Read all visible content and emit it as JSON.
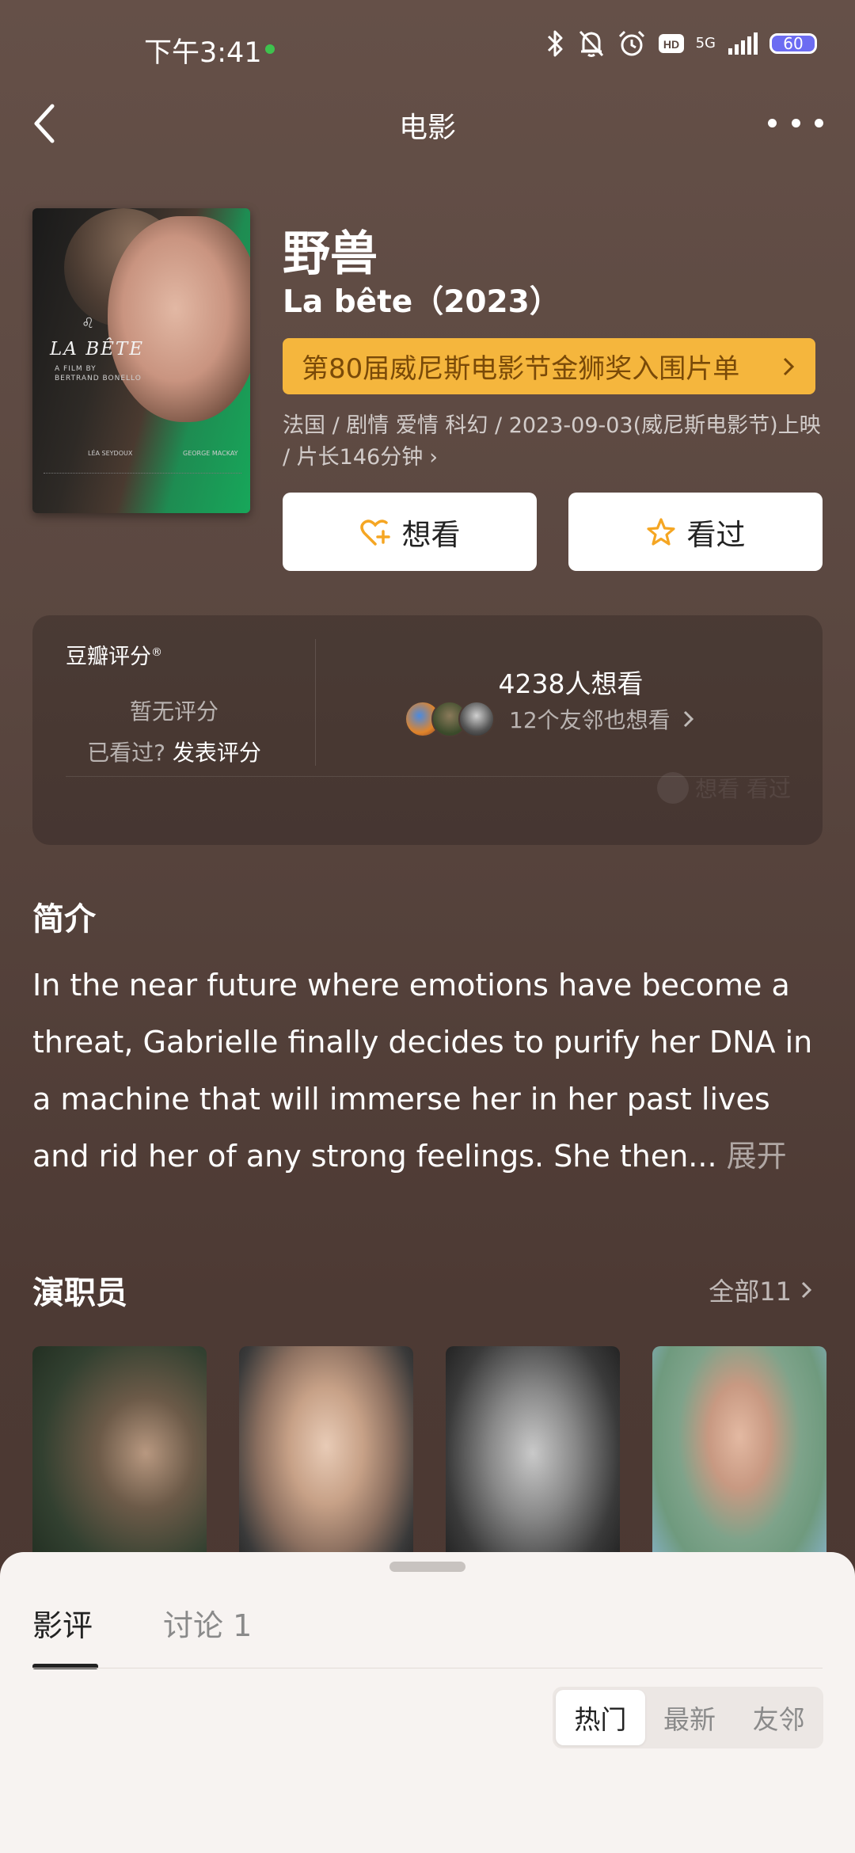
{
  "status_bar": {
    "time": "下午3:41",
    "network": "5G",
    "battery": "60"
  },
  "nav": {
    "title": "电影"
  },
  "movie": {
    "title": "野兽",
    "original_title": "La bête（2023）",
    "award": "第80届威尼斯电影节金狮奖入围片单",
    "meta": "法国 / 剧情 爱情 科幻 / 2023-09-03(威尼斯电影节)上映 / 片长146分钟",
    "poster": {
      "title": "LA BÊTE",
      "subtitle": "A FILM BY",
      "director": "BERTRAND BONELLO",
      "actor1": "LÉA SEYDOUX",
      "actor2": "GEORGE MACKAY"
    }
  },
  "actions": {
    "want_label": "想看",
    "seen_label": "看过"
  },
  "rating": {
    "label": "豆瓣评分",
    "mark": "®",
    "none": "暂无评分",
    "prompt": "已看过?",
    "write": "发表评分",
    "want_count": "4238人想看",
    "friends": "12个友邻也想看",
    "watermark": "想看 看过"
  },
  "intro": {
    "title": "简介",
    "text": "In the near future where emotions have become a threat, Gabrielle finally decides to purify her DNA in a machine that will immerse her in her past lives and rid her of any strong feelings. She then...",
    "expand": "展开"
  },
  "cast": {
    "title": "演职员",
    "all": "全部11"
  },
  "sheet": {
    "tabs": [
      "影评",
      "讨论 1"
    ],
    "sort": [
      "热门",
      "最新",
      "友邻"
    ]
  },
  "colors": {
    "accent": "#f5b63d",
    "background": "#4d3a33",
    "sheet": "#f7f3f1"
  },
  "icons": [
    "back-icon",
    "more-icon",
    "heart-plus-icon",
    "star-icon",
    "chevron-right-icon",
    "bluetooth-icon",
    "bell-off-icon",
    "alarm-icon",
    "hd-icon",
    "signal-icon",
    "battery-icon"
  ]
}
